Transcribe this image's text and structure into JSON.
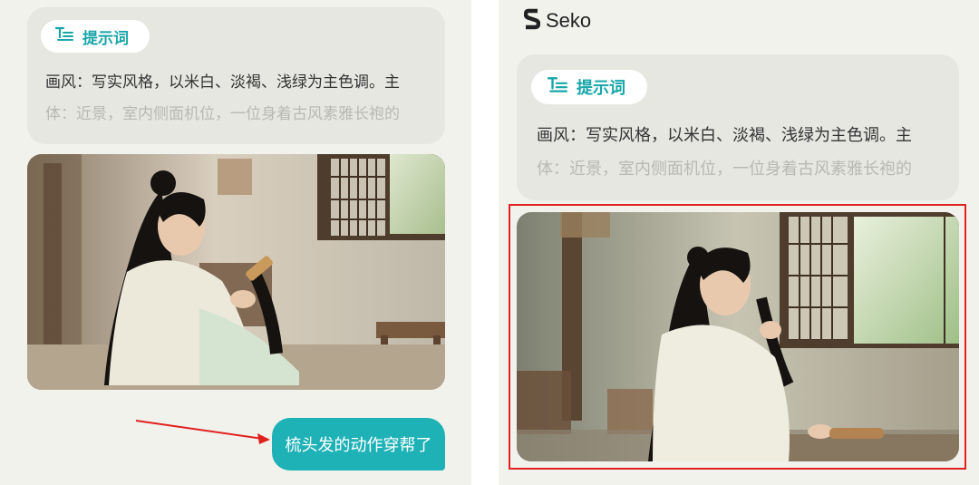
{
  "left_panel": {
    "prompt_card": {
      "tag_label": "提示词",
      "line1": "画风：写实风格，以米白、淡褐、浅绿为主色调。主",
      "line2": "体：近景，室内侧面机位，一位身着古风素雅长袍的"
    },
    "chat_bubble": "梳头发的动作穿帮了"
  },
  "right_panel": {
    "brand_name": "Seko",
    "prompt_card": {
      "tag_label": "提示词",
      "line1": "画风：写实风格，以米白、淡褐、浅绿为主色调。主",
      "line2": "体：近景，室内侧面机位，一位身着古风素雅长袍的"
    }
  },
  "colors": {
    "accent": "#1eb2b7",
    "tag_text": "#18a6a9",
    "highlight_border": "#e0221f",
    "arrow": "#e0221f",
    "panel_bg": "#f2f2ed",
    "card_bg": "#e7e7e1"
  },
  "icons": [
    "prompt-text-icon",
    "seko-logo-icon"
  ]
}
